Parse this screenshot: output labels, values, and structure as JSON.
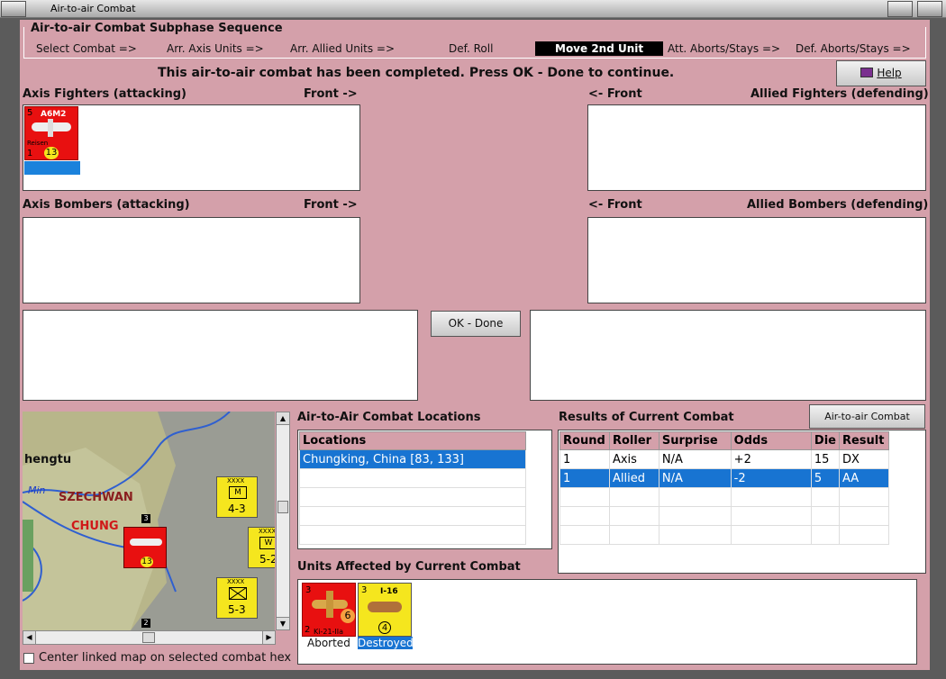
{
  "window": {
    "title": "Air-to-air Combat"
  },
  "sequence": {
    "title": "Air-to-air Combat Subphase Sequence",
    "steps": [
      "Select Combat =>",
      "Arr. Axis Units =>",
      "Arr. Allied Units =>",
      "Def. Roll",
      "Move 2nd Unit",
      "Att. Aborts/Stays =>",
      "Def. Aborts/Stays =>"
    ],
    "active_index": 4
  },
  "message": "This air-to-air combat has been completed.  Press OK - Done to continue.",
  "help_label": "Help",
  "panels": {
    "axis_fighters": "Axis Fighters (attacking)",
    "axis_fighters_front": "Front ->",
    "allied_fighters_front": "<- Front",
    "allied_fighters": "Allied Fighters (defending)",
    "axis_bombers": "Axis Bombers (attacking)",
    "axis_bombers_front": "Front ->",
    "allied_bombers_front": "<- Front",
    "allied_bombers": "Allied Bombers (defending)"
  },
  "ok_label": "OK - Done",
  "chart_button_label": "Air-to-air Combat Chart",
  "axis_unit": {
    "name": "A6M2",
    "type": "Reisen",
    "top_left": "5",
    "bottom_left": "1",
    "strength": "13",
    "color": "#e81010"
  },
  "locations": {
    "title": "Air-to-Air Combat Locations",
    "header": "Locations",
    "rows": [
      "Chungking, China [83, 133]"
    ]
  },
  "results": {
    "title": "Results of Current Combat",
    "headers": [
      "Round",
      "Roller",
      "Surprise",
      "Odds",
      "Die",
      "Result"
    ],
    "rows": [
      [
        "1",
        "Axis",
        "N/A",
        "+2",
        "15",
        "DX"
      ],
      [
        "1",
        "Allied",
        "N/A",
        "-2",
        "5",
        "AA"
      ]
    ],
    "selected_row": 1
  },
  "affected": {
    "title": "Units Affected by Current Combat",
    "units": [
      {
        "name": "Ki-21-IIa",
        "top_left": "3",
        "bottom_left": "2",
        "strength": "6",
        "status": "Aborted",
        "color": "#e81010"
      },
      {
        "name": "I-16",
        "top_left": "3",
        "strength": "4",
        "status": "Destroyed",
        "color": "#f5e61e"
      }
    ]
  },
  "map": {
    "labels": [
      "hengtu",
      "Min",
      "SZECHWAN",
      "CHUNG"
    ],
    "counters": [
      {
        "label": "XXXX",
        "value": "4-3",
        "letter": "M",
        "side": "Chungking"
      },
      {
        "label": "XXXX",
        "value": "5-2",
        "letter": "W",
        "side": "Chungking"
      },
      {
        "label": "XXXX",
        "value": "5-3",
        "letter": "",
        "side": "Nat Inf"
      }
    ],
    "hex_labels": [
      "3",
      "2"
    ]
  },
  "center_map_label": "Center linked map on selected combat hex"
}
